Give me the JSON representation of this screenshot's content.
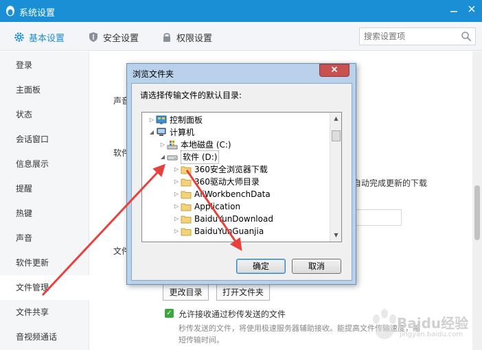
{
  "window": {
    "title": "系统设置"
  },
  "tabs": [
    {
      "label": "基本设置",
      "icon": "gear-icon"
    },
    {
      "label": "安全设置",
      "icon": "shield-icon"
    },
    {
      "label": "权限设置",
      "icon": "lock-icon"
    }
  ],
  "search": {
    "placeholder": "搜索设置项"
  },
  "sidebar": {
    "items": [
      {
        "label": "登录"
      },
      {
        "label": "主面板"
      },
      {
        "label": "状态"
      },
      {
        "label": "会话窗口"
      },
      {
        "label": "信息展示"
      },
      {
        "label": "提醒"
      },
      {
        "label": "热键"
      },
      {
        "label": "声音"
      },
      {
        "label": "软件更新"
      },
      {
        "label": "文件管理"
      },
      {
        "label": "文件共享"
      },
      {
        "label": "音视频通话"
      }
    ],
    "active_index": 9
  },
  "main": {
    "section_sound": "声音",
    "section_software": "软件",
    "section_file": "文件",
    "auto_update_hint": "自动完成更新的下载",
    "change_dir_button": "更改目录",
    "open_folder_button": "打开文件夹",
    "fast_receive_label": "允许接收通过秒传发送的文件",
    "fast_receive_desc": "秒传发送的文件，将使用极速服务器辅助接收。能提高文件传输速度，缩短传输时间。"
  },
  "dialog": {
    "title": "浏览文件夹",
    "prompt": "请选择传输文件的默认目录:",
    "ok": "确定",
    "cancel": "取消",
    "tree": [
      {
        "label": "控制面板",
        "level": 1,
        "expander": "collapsed",
        "icon": "control-panel-icon"
      },
      {
        "label": "计算机",
        "level": 1,
        "expander": "expanded",
        "icon": "computer-icon"
      },
      {
        "label": "本地磁盘 (C:)",
        "level": 2,
        "expander": "collapsed",
        "icon": "windows-drive-icon"
      },
      {
        "label": "软件 (D:)",
        "level": 2,
        "expander": "expanded",
        "icon": "drive-icon",
        "selected": true
      },
      {
        "label": "360安全浏览器下载",
        "level": 3,
        "expander": "collapsed",
        "icon": "folder-icon"
      },
      {
        "label": "360驱动大师目录",
        "level": 3,
        "expander": "collapsed",
        "icon": "folder-icon"
      },
      {
        "label": "AliWorkbenchData",
        "level": 3,
        "expander": "collapsed",
        "icon": "folder-icon"
      },
      {
        "label": "Application",
        "level": 3,
        "expander": "collapsed",
        "icon": "folder-icon"
      },
      {
        "label": "BaiduYunDownload",
        "level": 3,
        "expander": "collapsed",
        "icon": "folder-icon"
      },
      {
        "label": "BaiduYunGuanjia",
        "level": 3,
        "expander": "collapsed",
        "icon": "folder-icon"
      }
    ]
  },
  "watermark": {
    "brand": "Baidu经验",
    "url": "jingyan.baidu.com"
  },
  "colors": {
    "accent": "#1a8fd6",
    "annotation_arrow": "#e8403a"
  }
}
